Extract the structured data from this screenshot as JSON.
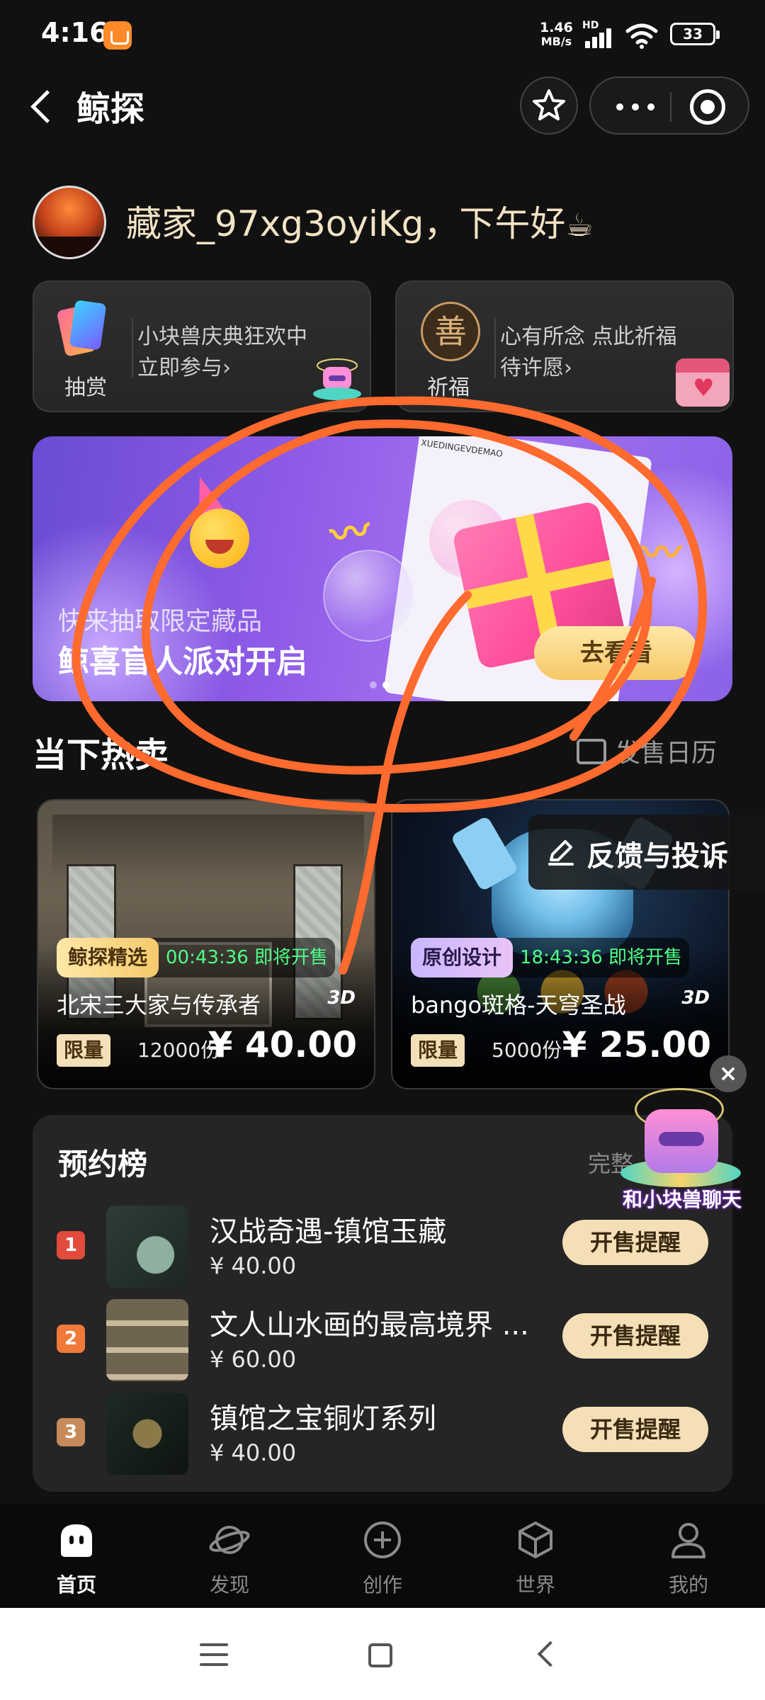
{
  "status_bar": {
    "time": "4:16",
    "net_speed_value": "1.46",
    "net_speed_unit": "MB/s",
    "hd": "HD",
    "battery": "33"
  },
  "header": {
    "title": "鲸探",
    "back_icon": "back-chevron-icon",
    "favorite_icon": "star-icon",
    "more_icon": "more-dots-icon",
    "close_icon": "target-circle-icon"
  },
  "greeting": {
    "text": "藏家_97xg3oyiKg，下午好",
    "emoji": "☕"
  },
  "entries": [
    {
      "icon_label": "抽赏",
      "line1": "小块兽庆典狂欢中",
      "line2": "立即参与›"
    },
    {
      "icon_label": "祈福",
      "line1": "心有所念 点此祈福",
      "line2": "待许愿›",
      "glyph": "善"
    }
  ],
  "banner": {
    "subtitle": "快来抽取限定藏品",
    "title": "鲸喜盲人派对开启",
    "cta": "去看看",
    "poster_text": "XUEDINGEVDEMAO",
    "active_dot": 1,
    "dot_count": 2
  },
  "hot": {
    "title": "当下热卖",
    "calendar_link": "发售日历"
  },
  "products": [
    {
      "tag": "鲸探精选",
      "countdown": "00:43:36 即将开售",
      "name": "北宋三大家与传承者",
      "badge_3d": "3D",
      "limit_label": "限量",
      "quantity": "12000份",
      "price": "¥ 40.00"
    },
    {
      "tag": "原创设计",
      "countdown": "18:43:36 即将开售",
      "name": "bango斑格-天穹圣战",
      "badge_3d": "3D",
      "limit_label": "限量",
      "quantity": "5000份",
      "price": "¥ 25.00"
    }
  ],
  "feedback": {
    "label": "反馈与投诉"
  },
  "board": {
    "title": "预约榜",
    "more": "完整",
    "items": [
      {
        "rank": "1",
        "name": "汉战奇遇-镇馆玉藏",
        "price": "¥ 40.00",
        "button": "开售提醒"
      },
      {
        "rank": "2",
        "name": "文人山水画的最高境界 ...",
        "price": "¥ 60.00",
        "button": "开售提醒"
      },
      {
        "rank": "3",
        "name": "镇馆之宝铜灯系列",
        "price": "¥ 40.00",
        "button": "开售提醒"
      }
    ]
  },
  "chatbot": {
    "label": "和小块兽聊天",
    "close": "×"
  },
  "tabs": [
    {
      "label": "首页",
      "icon": "home-icon",
      "active": true
    },
    {
      "label": "发现",
      "icon": "planet-icon",
      "active": false
    },
    {
      "label": "创作",
      "icon": "plus-circle-icon",
      "active": false
    },
    {
      "label": "世界",
      "icon": "cube-icon",
      "active": false
    },
    {
      "label": "我的",
      "icon": "person-icon",
      "active": false
    }
  ],
  "colors": {
    "background": "#111111",
    "accent_gold": "#f4dfb6",
    "countdown_green": "#4dff86",
    "scribble": "#ff6a2e",
    "rank1": "#e24a3c",
    "rank2": "#f07a3a",
    "rank3": "#c88a5a"
  }
}
